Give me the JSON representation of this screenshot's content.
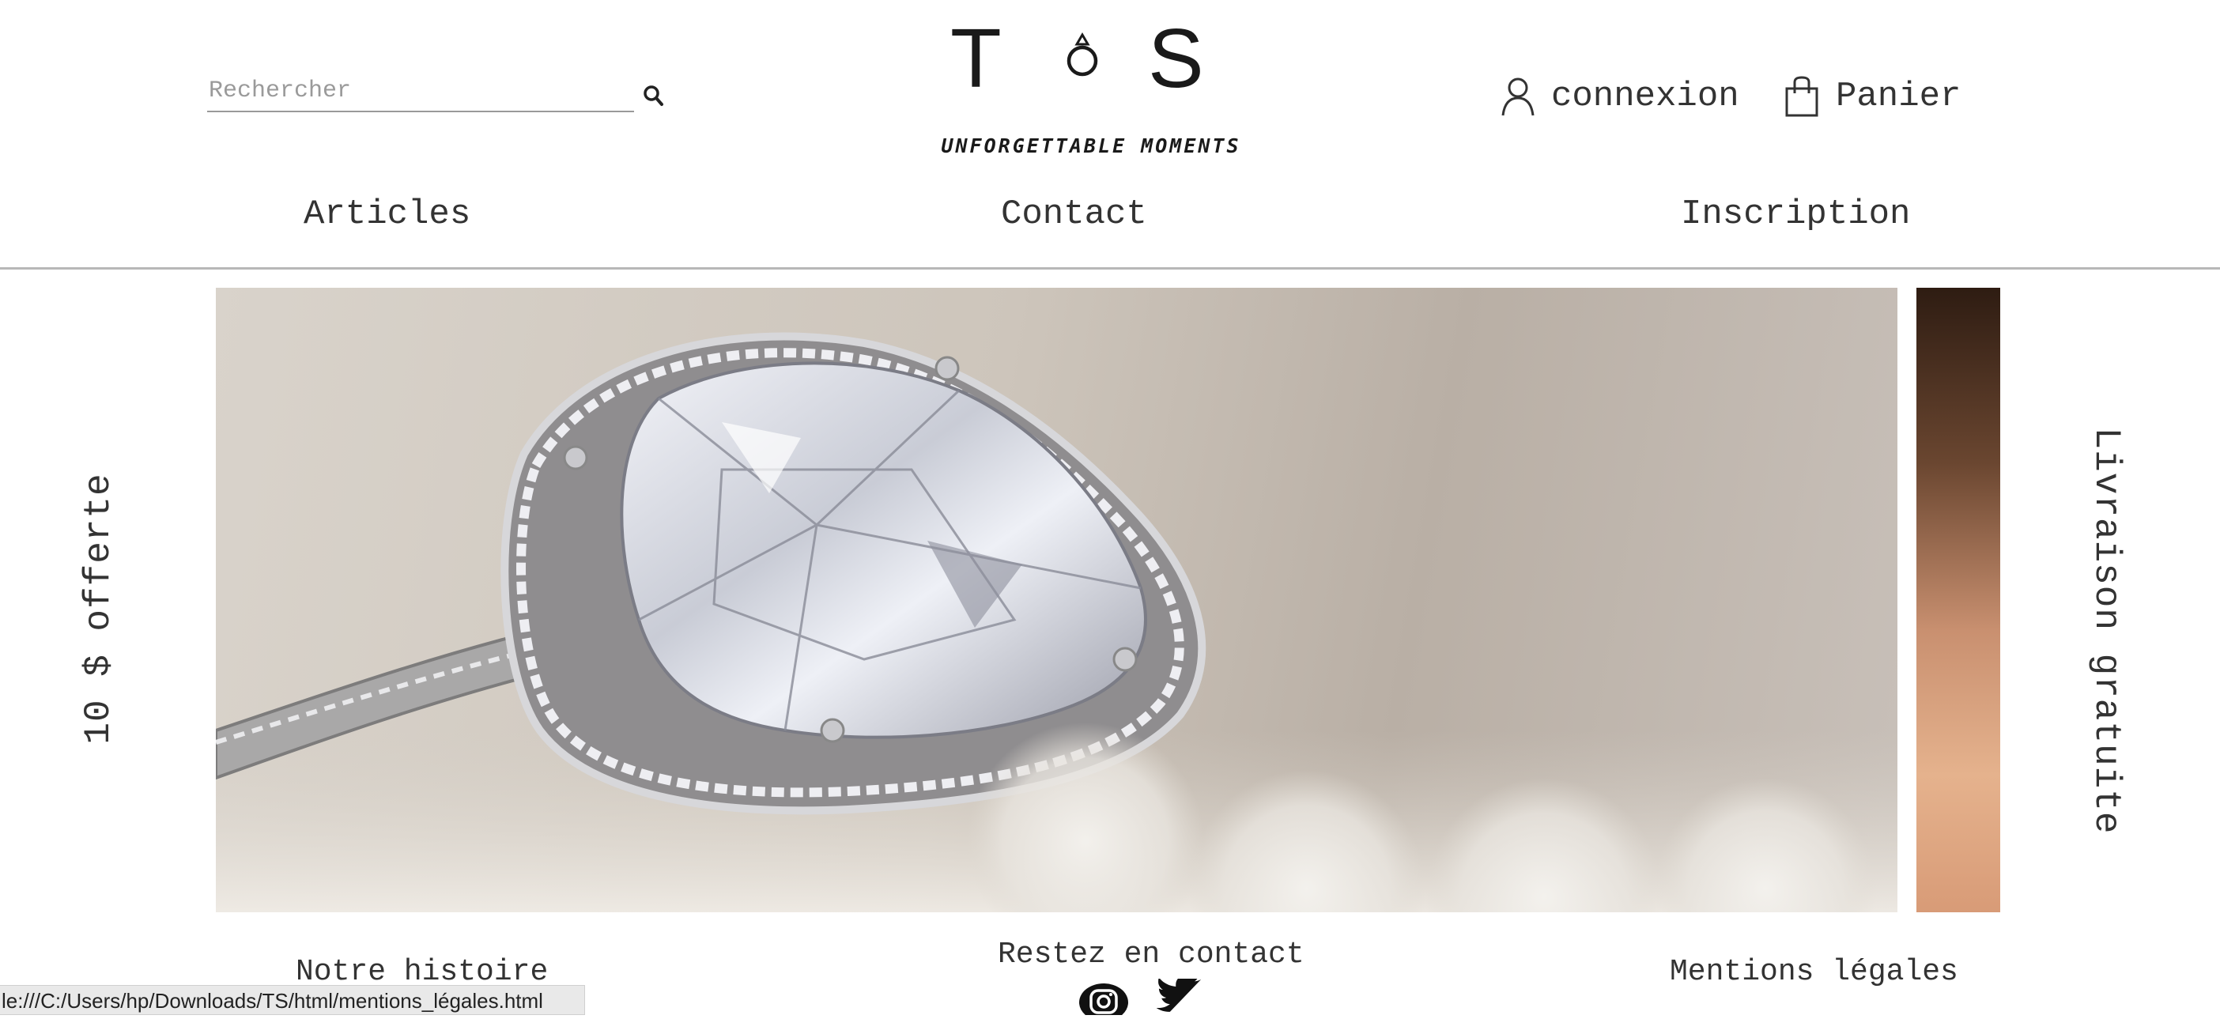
{
  "header": {
    "search": {
      "placeholder": "Rechercher",
      "icon": "search-icon"
    },
    "logo": {
      "letter_left": "T",
      "letter_right": "S",
      "tagline": "UNFORGETTABLE MOMENTS"
    },
    "account": {
      "login_label": "connexion",
      "login_icon": "user-icon",
      "cart_label": "Panier",
      "cart_icon": "shopping-bag-icon"
    }
  },
  "nav": {
    "items": [
      "Articles",
      "Contact",
      "Inscription"
    ]
  },
  "hero": {
    "left_text": "10 $ offerte",
    "right_text": "Livraison gratuite",
    "slide_subject": "diamond ring"
  },
  "footer": {
    "story": "Notre histoire",
    "contact_heading": "Restez en contact",
    "legal": "Mentions légales",
    "social_icons": [
      "instagram-icon",
      "twitter-icon"
    ]
  },
  "status_bar": {
    "url": "le:///C:/Users/hp/Downloads/TS/html/mentions_légales.html"
  },
  "colors": {
    "text": "#2b2b2b",
    "rule": "#b8b8b8",
    "placeholder": "#9a9a9a"
  }
}
